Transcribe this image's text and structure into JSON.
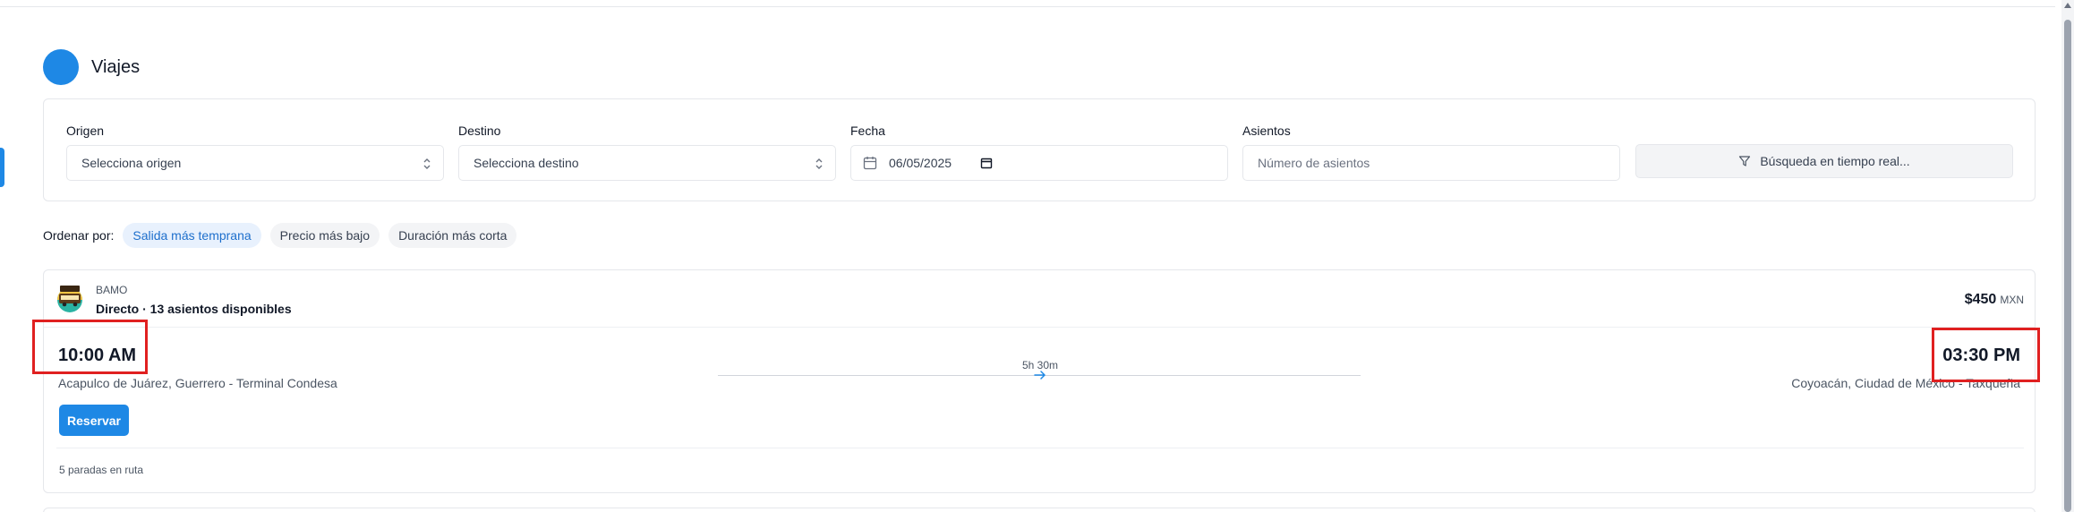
{
  "app": {
    "title": "Viajes"
  },
  "filters": {
    "origin": {
      "label": "Origen",
      "value": "Selecciona origen"
    },
    "destination": {
      "label": "Destino",
      "value": "Selecciona destino"
    },
    "date": {
      "label": "Fecha",
      "value": "06/05/2025"
    },
    "seats": {
      "label": "Asientos",
      "placeholder": "Número de asientos"
    },
    "search_button": "Búsqueda en tiempo real..."
  },
  "sort": {
    "label": "Ordenar por:",
    "options": [
      "Salida más temprana",
      "Precio más bajo",
      "Duración más corta"
    ],
    "active_index": 0
  },
  "trips": [
    {
      "company": "BAMO",
      "summary": "Directo · 13 asientos disponibles",
      "price": "$450",
      "currency": "MXN",
      "departure_time": "10:00 AM",
      "departure_place": "Acapulco de Juárez, Guerrero - Terminal Condesa",
      "arrival_time": "03:30 PM",
      "arrival_place": "Coyoacán, Ciudad de México - Taxqueña",
      "duration": "5h 30m",
      "reserve_label": "Reservar",
      "stops": "5 paradas en ruta"
    }
  ],
  "colors": {
    "accent": "#1e88e5",
    "highlight": "#e02020"
  },
  "icons": {
    "origin_select": "chevron-updown-icon",
    "destination_select": "chevron-updown-icon",
    "date": "calendar-icon",
    "search": "filter-icon",
    "route": "arrow-right-icon"
  }
}
